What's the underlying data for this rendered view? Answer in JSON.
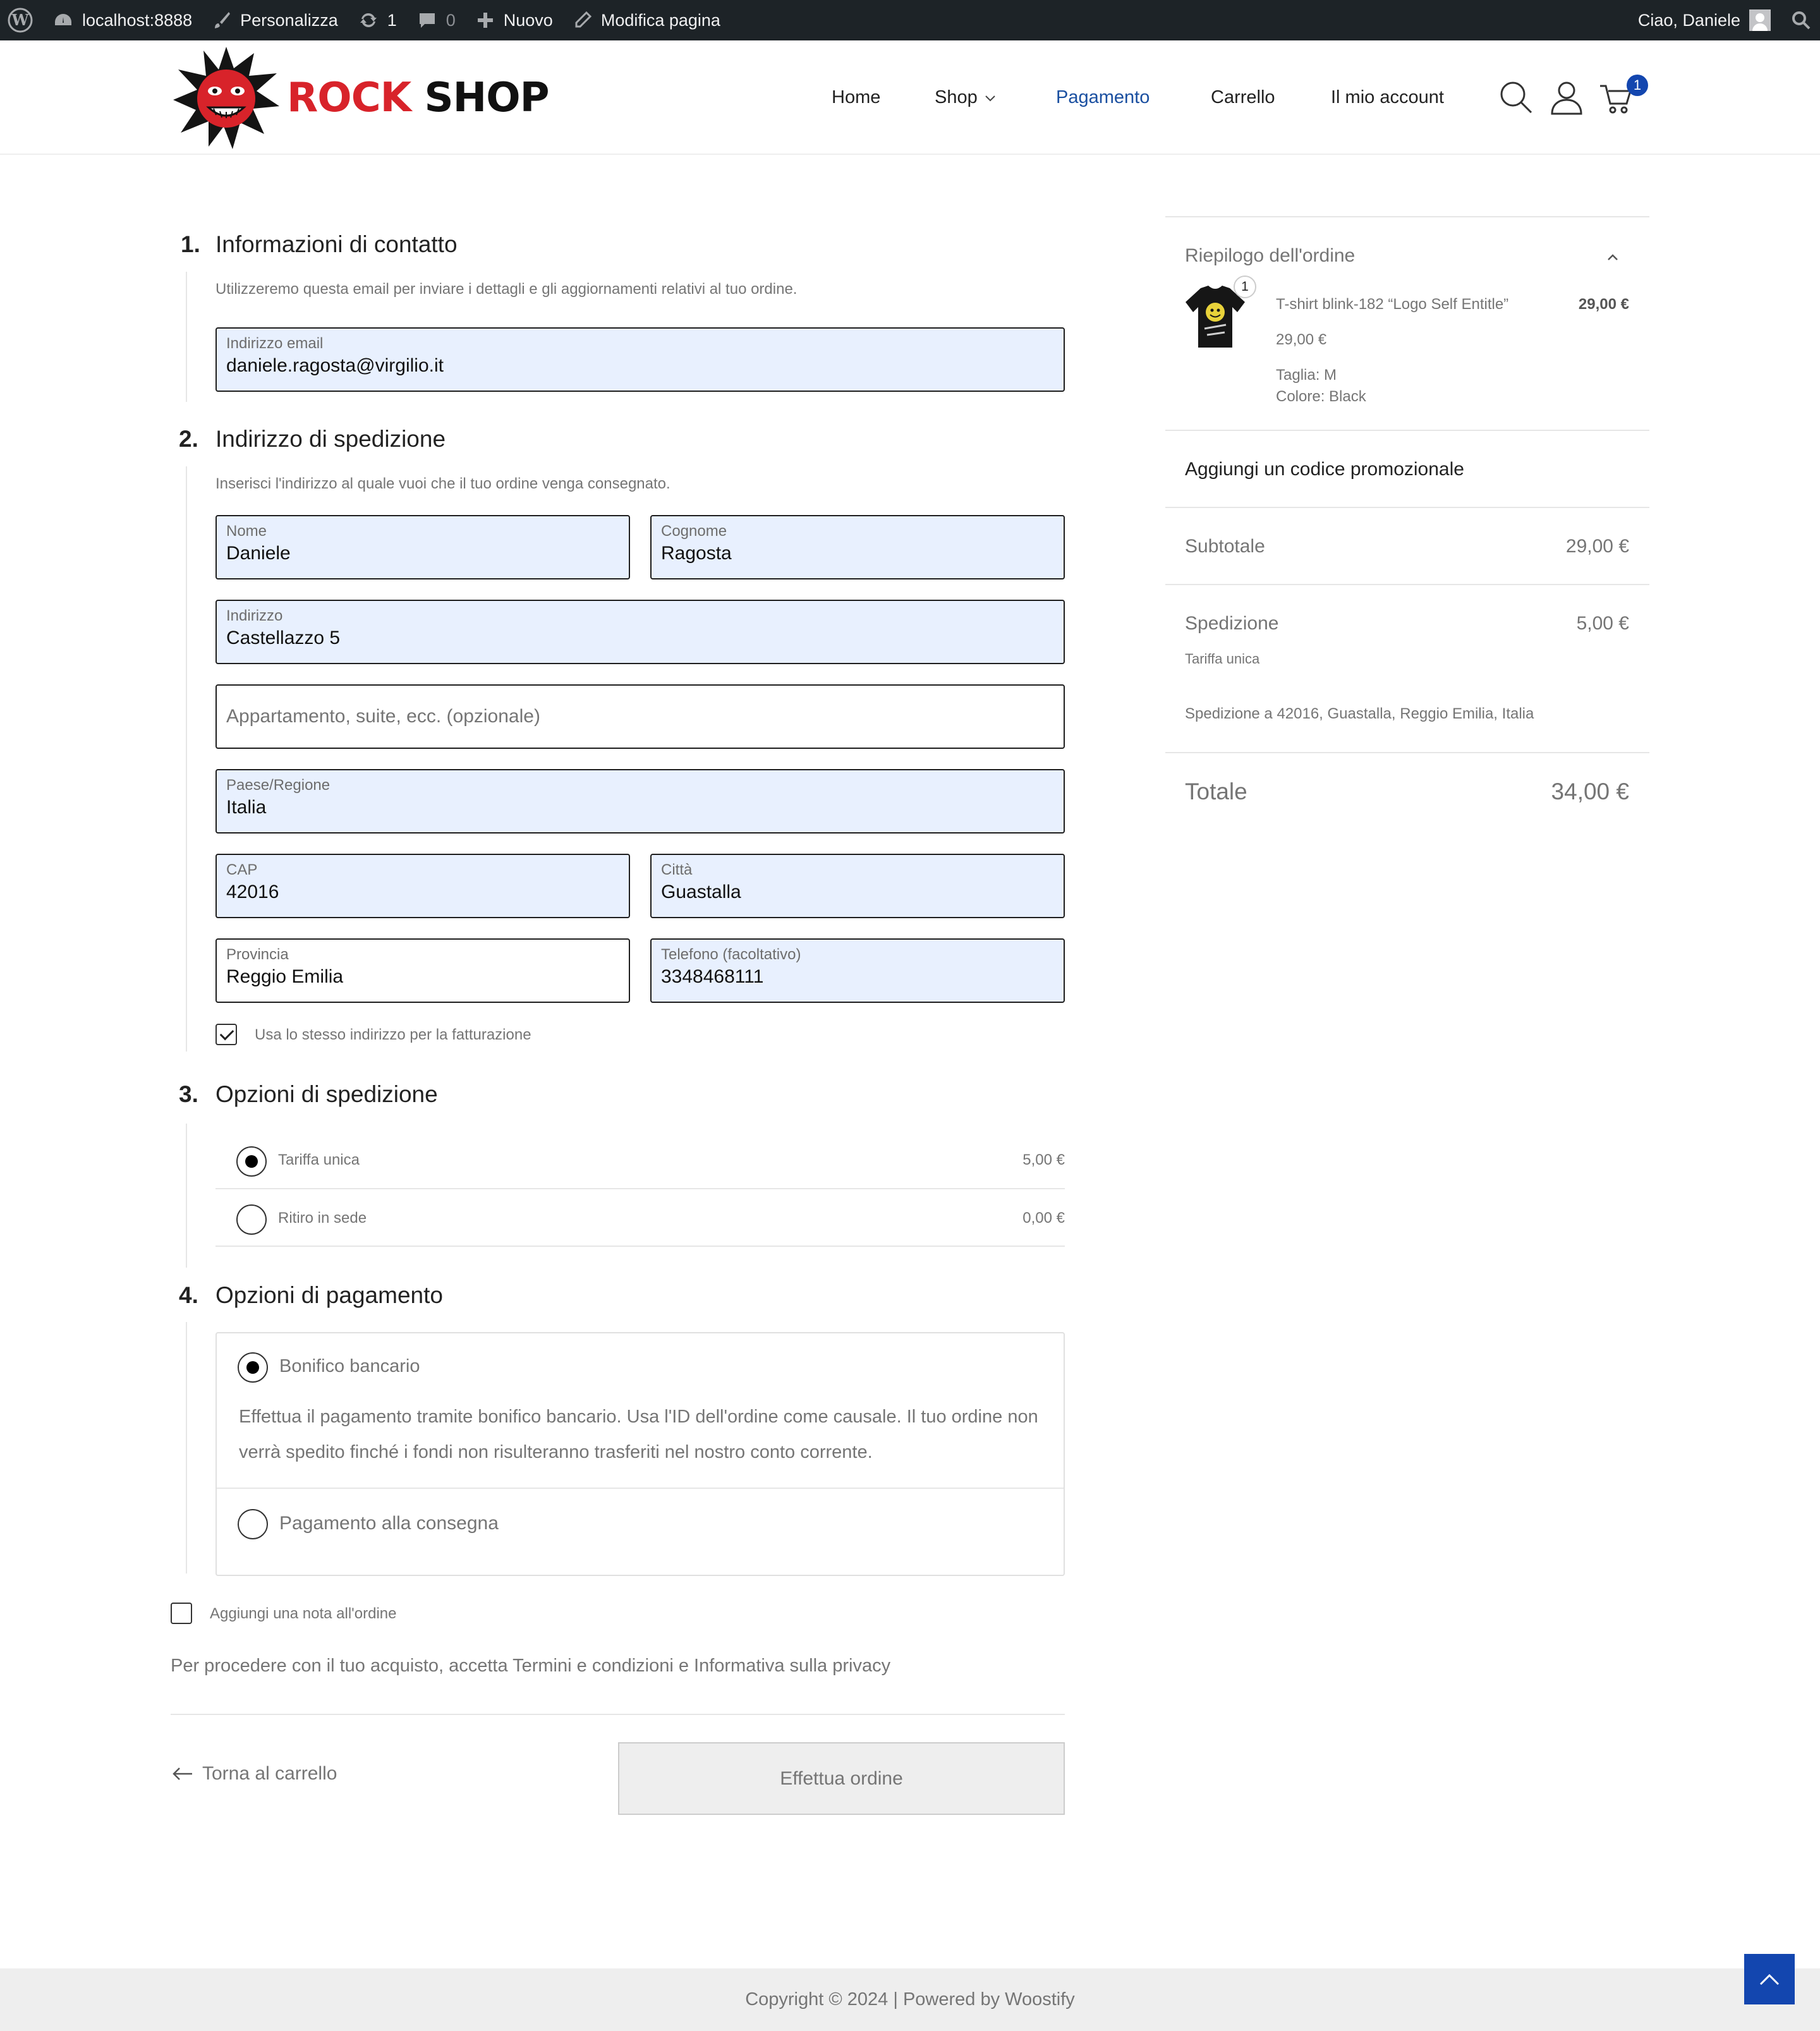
{
  "adminbar": {
    "site": "localhost:8888",
    "customize": "Personalizza",
    "updates_count": "1",
    "comments_count": "0",
    "new": "Nuovo",
    "edit_page": "Modifica pagina",
    "greeting": "Ciao, Daniele"
  },
  "header": {
    "logo_word1": "ROCK",
    "logo_word2": "SHOP",
    "nav": [
      "Home",
      "Shop",
      "Pagamento",
      "Carrello",
      "Il mio account"
    ],
    "cart_count": "1"
  },
  "contact": {
    "number": "1.",
    "title": "Informazioni di contatto",
    "desc": "Utilizzeremo questa email per inviare i dettagli e gli aggiornamenti relativi al tuo ordine.",
    "email_label": "Indirizzo email",
    "email_value": "daniele.ragosta@virgilio.it"
  },
  "shipping_address": {
    "number": "2.",
    "title": "Indirizzo di spedizione",
    "desc": "Inserisci l'indirizzo al quale vuoi che il tuo ordine venga consegnato.",
    "first_name_label": "Nome",
    "first_name": "Daniele",
    "last_name_label": "Cognome",
    "last_name": "Ragosta",
    "address_label": "Indirizzo",
    "address": "Castellazzo 5",
    "address2_placeholder": "Appartamento, suite, ecc. (opzionale)",
    "country_label": "Paese/Regione",
    "country": "Italia",
    "zip_label": "CAP",
    "zip": "42016",
    "city_label": "Città",
    "city": "Guastalla",
    "province_label": "Provincia",
    "province": "Reggio Emilia",
    "phone_label": "Telefono (facoltativo)",
    "phone": "3348468111",
    "same_billing": "Usa lo stesso indirizzo per la fatturazione"
  },
  "shipping_options": {
    "number": "3.",
    "title": "Opzioni di spedizione",
    "options": [
      {
        "label": "Tariffa unica",
        "price": "5,00 €"
      },
      {
        "label": "Ritiro in sede",
        "price": "0,00 €"
      }
    ]
  },
  "payment": {
    "number": "4.",
    "title": "Opzioni di pagamento",
    "bank_label": "Bonifico bancario",
    "bank_desc": "Effettua il pagamento tramite bonifico bancario. Usa l'ID dell'ordine come causale. Il tuo ordine non verrà spedito finché i fondi non risulteranno trasferiti nel nostro conto corrente.",
    "cod_label": "Pagamento alla consegna"
  },
  "order_note": "Aggiungi una nota all'ordine",
  "terms": "Per procedere con il tuo acquisto, accetta Termini e condizioni e Informativa sulla privacy",
  "back_to_cart": "Torna al carrello",
  "place_order": "Effettua ordine",
  "summary": {
    "title": "Riepilogo dell'ordine",
    "item_qty": "1",
    "item_name": "T-shirt blink-182 “Logo Self Entitle”",
    "item_total": "29,00 €",
    "item_price": "29,00 €",
    "item_size": "Taglia: M",
    "item_color": "Colore: Black",
    "coupon": "Aggiungi un codice promozionale",
    "subtotal_label": "Subtotale",
    "subtotal": "29,00 €",
    "shipping_label": "Spedizione",
    "shipping": "5,00 €",
    "shipping_method": "Tariffa unica",
    "shipping_to": "Spedizione a 42016, Guastalla, Reggio Emilia, Italia",
    "total_label": "Totale",
    "total": "34,00 €"
  },
  "footer": "Copyright © 2024 | Powered by Woostify",
  "colors": {
    "accent": "#1346af",
    "brand_red": "#d8232a",
    "autofill": "#e8f0fe",
    "adminbar": "#1d2327"
  }
}
